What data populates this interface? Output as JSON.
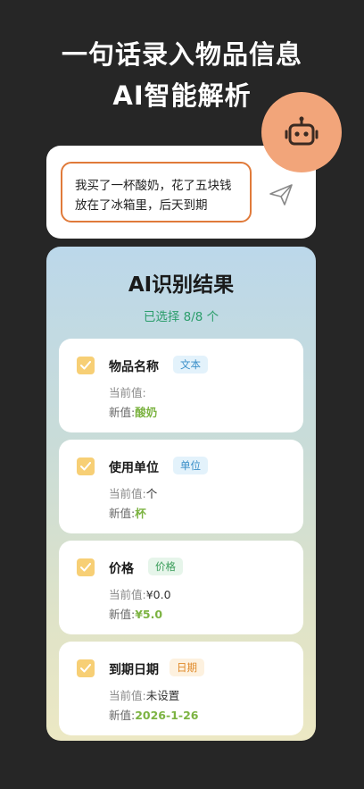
{
  "headline": {
    "line1": "一句话录入物品信息",
    "line2": "AI智能解析"
  },
  "icons": {
    "assistant": "robot-icon",
    "send": "send-paper-plane-icon",
    "check": "check-icon"
  },
  "input": {
    "line1": "我买了一杯酸奶，花了五块钱",
    "line2": "放在了冰箱里，后天到期"
  },
  "result": {
    "title": "AI识别结果",
    "selected_count": "已选择 8/8 个",
    "current_label": "当前值:",
    "new_label": "新值:",
    "items": [
      {
        "name": "物品名称",
        "type": "文本",
        "current": "",
        "new": "酸奶",
        "checked": true
      },
      {
        "name": "使用单位",
        "type": "单位",
        "current": "个",
        "new": "杯",
        "checked": true
      },
      {
        "name": "价格",
        "type": "价格",
        "current": "¥0.0",
        "new": "¥5.0",
        "checked": true
      },
      {
        "name": "到期日期",
        "type": "日期",
        "current": "未设置",
        "new": "2026-1-26",
        "checked": true
      }
    ]
  },
  "colors": {
    "background": "#262626",
    "accent_orange": "#e07a3a",
    "robot_badge": "#f2a57a",
    "checkbox": "#f7cf75",
    "new_value_green": "#7cb342",
    "count_green": "#2a9d6a"
  }
}
